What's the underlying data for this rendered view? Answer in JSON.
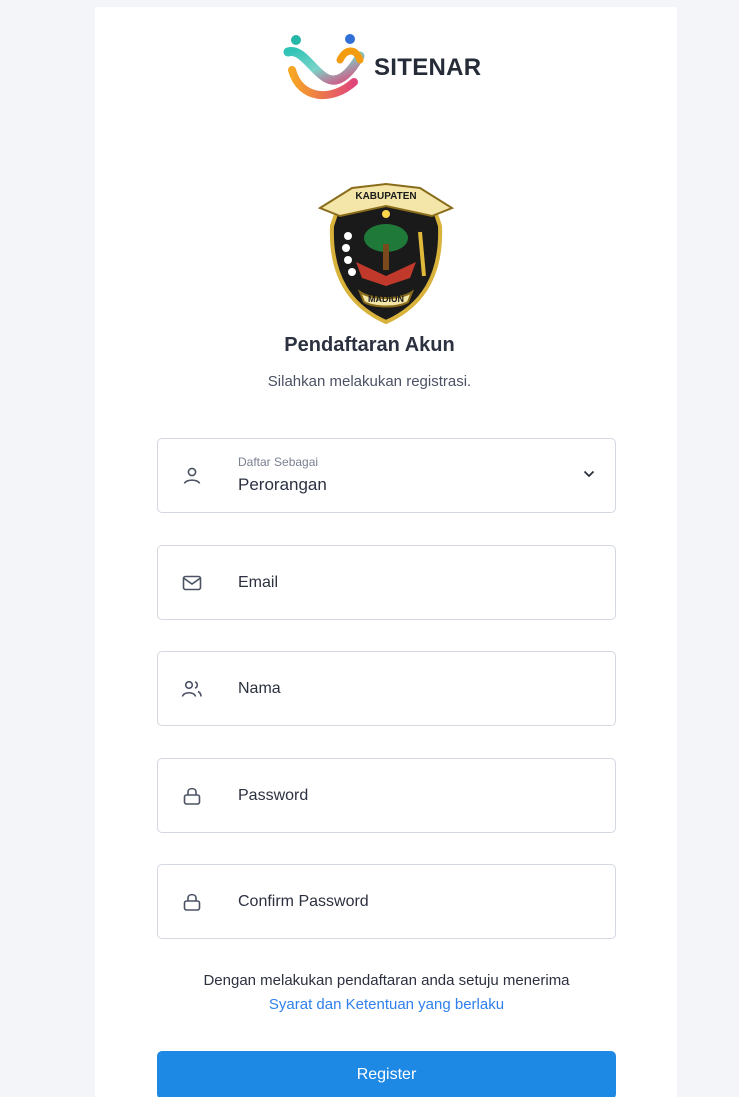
{
  "brand": {
    "name": "SITENAR"
  },
  "emblem": {
    "top_text": "KABUPATEN",
    "bottom_text": "MADIUN"
  },
  "header": {
    "title": "Pendaftaran Akun",
    "subtitle": "Silahkan melakukan registrasi."
  },
  "form": {
    "role_select": {
      "label": "Daftar Sebagai",
      "value": "Perorangan"
    },
    "email_placeholder": "Email",
    "name_placeholder": "Nama",
    "password_placeholder": "Password",
    "confirm_password_placeholder": "Confirm Password"
  },
  "terms": {
    "text": "Dengan melakukan pendaftaran anda setuju menerima",
    "link": "Syarat dan Ketentuan yang berlaku"
  },
  "register_button": "Register",
  "colors": {
    "primary": "#1e88e5",
    "link": "#2f80ed",
    "background": "#f4f5f9"
  }
}
